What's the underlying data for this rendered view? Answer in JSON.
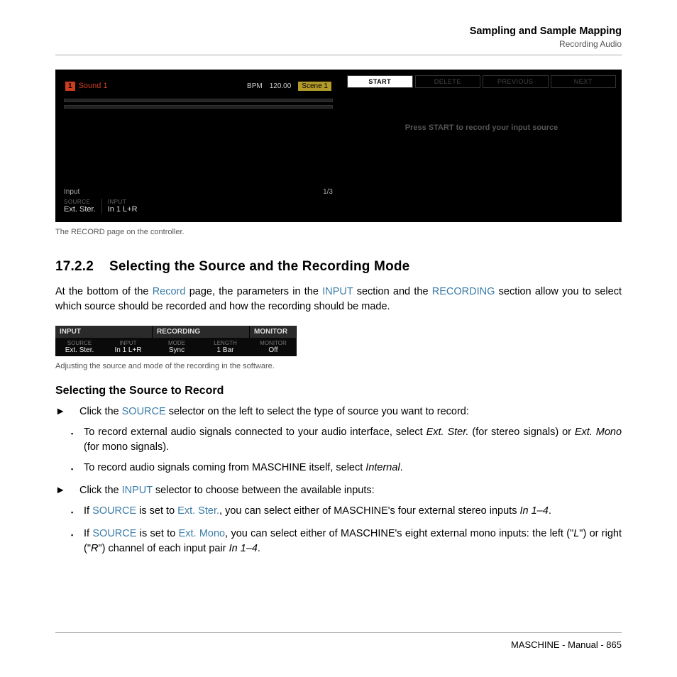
{
  "header": {
    "title": "Sampling and Sample Mapping",
    "sub": "Recording Audio"
  },
  "sc1": {
    "sound_num": "1",
    "sound_name": "Sound 1",
    "bpm_label": "BPM",
    "bpm_val": "120.00",
    "scene": "Scene 1",
    "input_label": "Input",
    "page_ind": "1/3",
    "p1_lbl": "SOURCE",
    "p1_val": "Ext. Ster.",
    "p2_lbl": "INPUT",
    "p2_val": "In 1 L+R",
    "btn_start": "START",
    "btn_delete": "DELETE",
    "btn_prev": "PREVIOUS",
    "btn_next": "NEXT",
    "press_msg": "Press START to record your input source"
  },
  "cap1": "The RECORD page on the controller.",
  "sec_num": "17.2.2",
  "sec_title": "Selecting the Source and the Recording Mode",
  "para1_a": "At the bottom of the ",
  "para1_link1": "Record",
  "para1_b": " page, the parameters in the ",
  "para1_link2": "INPUT",
  "para1_c": " section and the ",
  "para1_link3": "RECORDING",
  "para1_d": " section allow you to select which source should be recorded and how the recording should be made.",
  "sc2": {
    "h_input": "INPUT",
    "h_rec": "RECORDING",
    "h_mon": "MONITOR",
    "c1_lbl": "SOURCE",
    "c1_val": "Ext. Ster.",
    "c2_lbl": "INPUT",
    "c2_val": "In 1 L+R",
    "c3_lbl": "MODE",
    "c3_val": "Sync",
    "c4_lbl": "LENGTH",
    "c4_val": "1 Bar",
    "c5_lbl": "MONITOR",
    "c5_val": "Off"
  },
  "cap2": "Adjusting the source and mode of the recording in the software.",
  "sub1": "Selecting the Source to Record",
  "li1_a": "Click the ",
  "li1_link": "SOURCE",
  "li1_b": " selector on the left to select the type of source you want to record:",
  "li2_a": "To record external audio signals connected to your audio interface, select ",
  "li2_i1": "Ext. Ster.",
  "li2_b": " (for stereo signals) or ",
  "li2_i2": "Ext. Mono",
  "li2_c": " (for mono signals).",
  "li3_a": "To record audio signals coming from MASCHINE itself, select ",
  "li3_i1": "Internal",
  "li3_b": ".",
  "li4_a": "Click the ",
  "li4_link": "INPUT",
  "li4_b": " selector to choose between the available inputs:",
  "li5_a": "If ",
  "li5_l1": "SOURCE",
  "li5_b": " is set to ",
  "li5_l2": "Ext. Ster.",
  "li5_c": ", you can select either of MASCHINE's four external stereo inputs ",
  "li5_i1": "In 1–4",
  "li5_d": ".",
  "li6_a": "If ",
  "li6_l1": "SOURCE",
  "li6_b": " is set to ",
  "li6_l2": "Ext. Mono",
  "li6_c": ", you can select either of MASCHINE's eight external mono inputs: the left (\"",
  "li6_i1": "L",
  "li6_d": "\") or right (\"",
  "li6_i2": "R",
  "li6_e": "\") channel of each input pair ",
  "li6_i3": "In 1–4",
  "li6_f": ".",
  "footer": "MASCHINE - Manual - 865"
}
